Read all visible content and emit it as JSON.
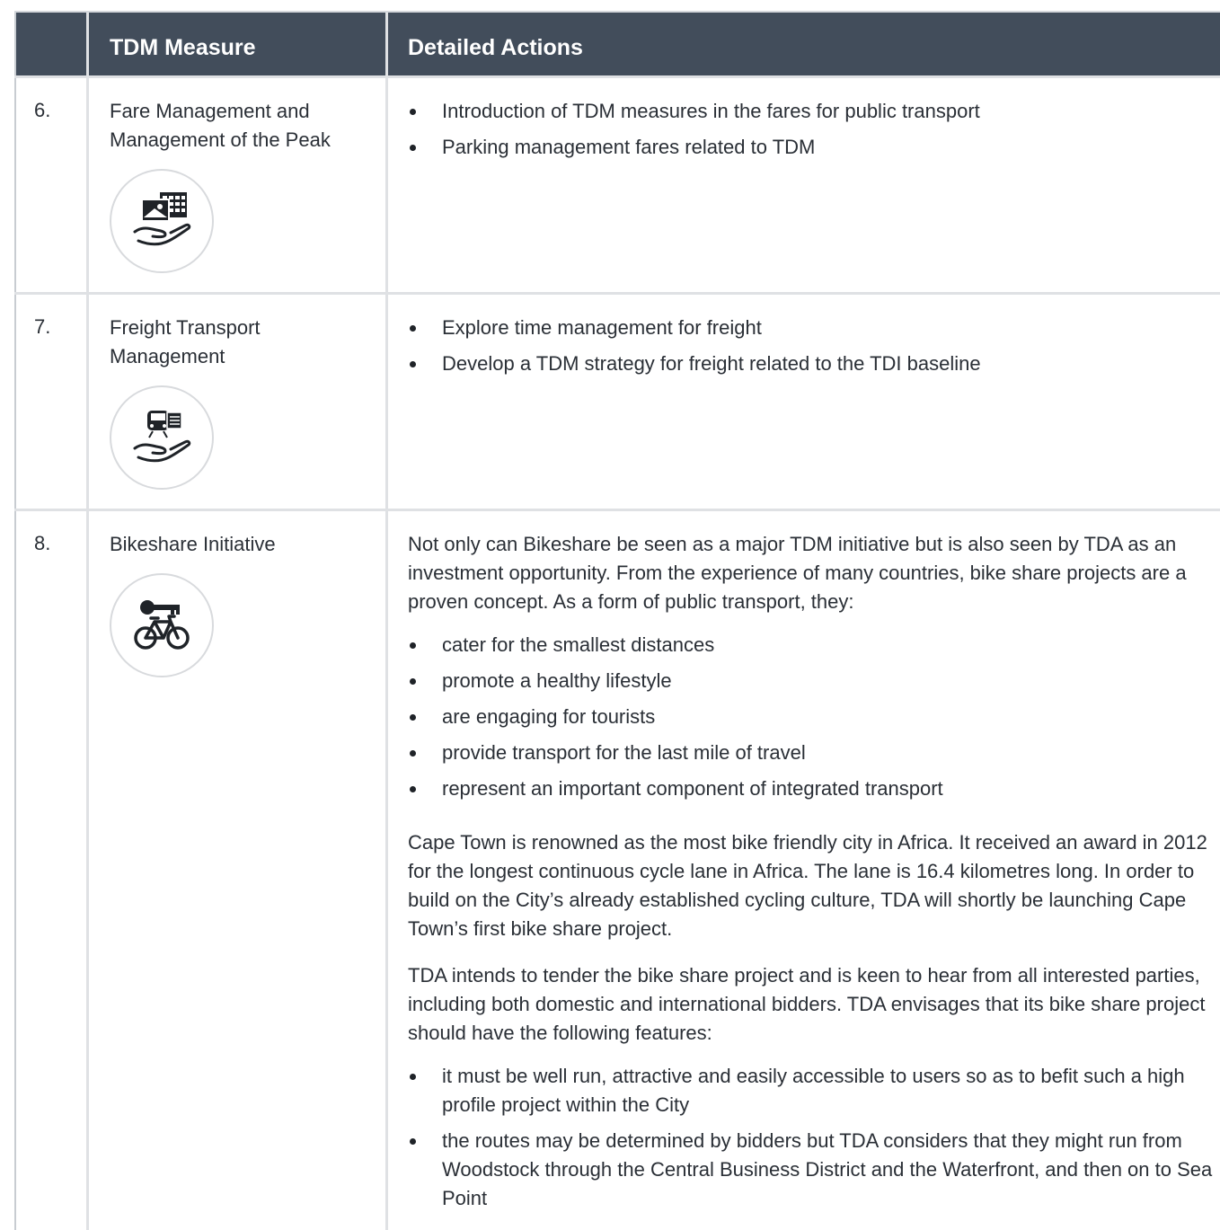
{
  "header": {
    "col1": "",
    "col2": "TDM Measure",
    "col3": "Detailed Actions"
  },
  "rows": [
    {
      "number": "6.",
      "measure": "Fare Management and Management of the Peak",
      "icon": "hand-holding-fare-card-icon",
      "bullets": [
        "Introduction of TDM measures in the fares for public transport",
        "Parking management fares related to TDM"
      ]
    },
    {
      "number": "7.",
      "measure": "Freight Transport Management",
      "icon": "hand-holding-freight-train-icon",
      "bullets": [
        "Explore time management for freight",
        "Develop a TDM strategy for freight related to the TDI baseline"
      ]
    },
    {
      "number": "8.",
      "measure": "Bikeshare Initiative",
      "icon": "bicycle-with-key-icon",
      "intro": "Not only can Bikeshare be seen as a major TDM initiative but is also seen by TDA as an investment opportunity. From the experience of many countries, bike share projects are a proven concept. As a form of public transport, they:",
      "bullets": [
        "cater for the smallest distances",
        "promote a healthy lifestyle",
        "are engaging for tourists",
        "provide transport for the last mile of travel",
        "represent an important component of integrated transport"
      ],
      "para2": "Cape Town is renowned as the most bike friendly city in Africa. It received an award in 2012 for the longest continuous cycle lane in Africa. The lane is 16.4 kilometres long. In order to build on the City’s already established cycling culture, TDA will shortly be launching Cape Town’s first bike share project.",
      "para3": "TDA intends to tender the bike share project and is keen to hear from all interested parties, including both domestic and international bidders. TDA envisages that its bike share project should have the following features:",
      "bullets2": [
        "it must be well run, attractive and easily accessible to users so as to befit such a high profile project within the City",
        "the routes may be determined by bidders but TDA considers that they might run from Woodstock through the Central Business District and the Waterfront, and then on to Sea Point"
      ]
    }
  ]
}
